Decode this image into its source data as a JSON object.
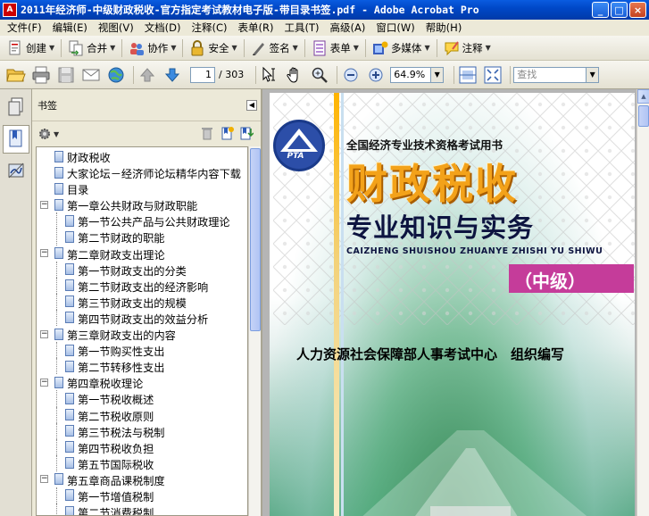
{
  "window": {
    "title": "2011年经济师-中级财政税收-官方指定考试教材电子版-带目录书签.pdf - Adobe Acrobat Pro",
    "app_icon_label": "A",
    "minimize": "_",
    "maximize": "□",
    "close": "×"
  },
  "menu": [
    "文件(F)",
    "编辑(E)",
    "视图(V)",
    "文档(D)",
    "注释(C)",
    "表单(R)",
    "工具(T)",
    "高级(A)",
    "窗口(W)",
    "帮助(H)"
  ],
  "task_toolbar": {
    "create": "创建",
    "combine": "合并",
    "collaborate": "协作",
    "secure": "安全",
    "sign": "签名",
    "forms": "表单",
    "multimedia": "多媒体",
    "comment": "注释"
  },
  "nav_toolbar": {
    "current_page": "1",
    "total_pages": "/ 303",
    "zoom": "64.9%",
    "search_placeholder": "查找"
  },
  "bookmarks_panel": {
    "title": "书签",
    "items": [
      {
        "label": "财政税收",
        "level": 0,
        "expander": ""
      },
      {
        "label": "大家论坛－经济师论坛精华内容下载",
        "level": 0,
        "expander": ""
      },
      {
        "label": "目录",
        "level": 0,
        "expander": ""
      },
      {
        "label": "第一章公共财政与财政职能",
        "level": 0,
        "expander": "−"
      },
      {
        "label": "第一节公共产品与公共财政理论",
        "level": 1,
        "expander": ""
      },
      {
        "label": "第二节财政的职能",
        "level": 1,
        "expander": ""
      },
      {
        "label": "第二章财政支出理论",
        "level": 0,
        "expander": "−"
      },
      {
        "label": "第一节财政支出的分类",
        "level": 1,
        "expander": ""
      },
      {
        "label": "第二节财政支出的经济影响",
        "level": 1,
        "expander": ""
      },
      {
        "label": "第三节财政支出的规模",
        "level": 1,
        "expander": ""
      },
      {
        "label": "第四节财政支出的效益分析",
        "level": 1,
        "expander": ""
      },
      {
        "label": "第三章财政支出的内容",
        "level": 0,
        "expander": "−"
      },
      {
        "label": "第一节购买性支出",
        "level": 1,
        "expander": ""
      },
      {
        "label": "第二节转移性支出",
        "level": 1,
        "expander": ""
      },
      {
        "label": "第四章税收理论",
        "level": 0,
        "expander": "−"
      },
      {
        "label": "第一节税收概述",
        "level": 1,
        "expander": ""
      },
      {
        "label": "第二节税收原则",
        "level": 1,
        "expander": ""
      },
      {
        "label": "第三节税法与税制",
        "level": 1,
        "expander": ""
      },
      {
        "label": "第四节税收负担",
        "level": 1,
        "expander": ""
      },
      {
        "label": "第五节国际税收",
        "level": 1,
        "expander": ""
      },
      {
        "label": "第五章商品课税制度",
        "level": 0,
        "expander": "−"
      },
      {
        "label": "第一节增值税制",
        "level": 1,
        "expander": ""
      },
      {
        "label": "第二节消费税制",
        "level": 1,
        "expander": ""
      }
    ]
  },
  "cover": {
    "logo_text": "PTA",
    "top_line": "全国经济专业技术资格考试用书",
    "title": "财政税收",
    "subtitle": "专业知识与实务",
    "pinyin": "CAIZHENG SHUISHOU ZHUANYE ZHISHI YU SHIWU",
    "level": "（中级）",
    "author": "人力资源社会保障部人事考试中心　组织编写"
  }
}
